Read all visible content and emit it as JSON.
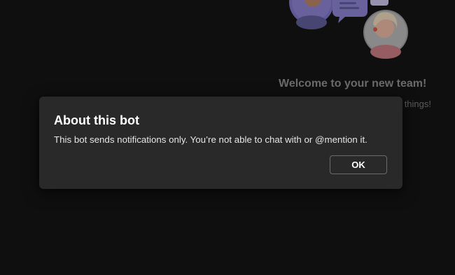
{
  "background": {
    "welcome_title": "Welcome to your new team!",
    "welcome_subtitle": "things!",
    "illustration_icon": "team-chat-illustration"
  },
  "dialog": {
    "title": "About this bot",
    "message": "This bot sends notifications only. You’re not able to chat with or @mention it.",
    "ok_label": "OK"
  },
  "colors": {
    "page_background": "#141414",
    "dialog_background": "#292929",
    "button_border": "#6b6b6b",
    "illustration_purple": "#7f76c9",
    "illustration_pink": "#c77b82"
  }
}
